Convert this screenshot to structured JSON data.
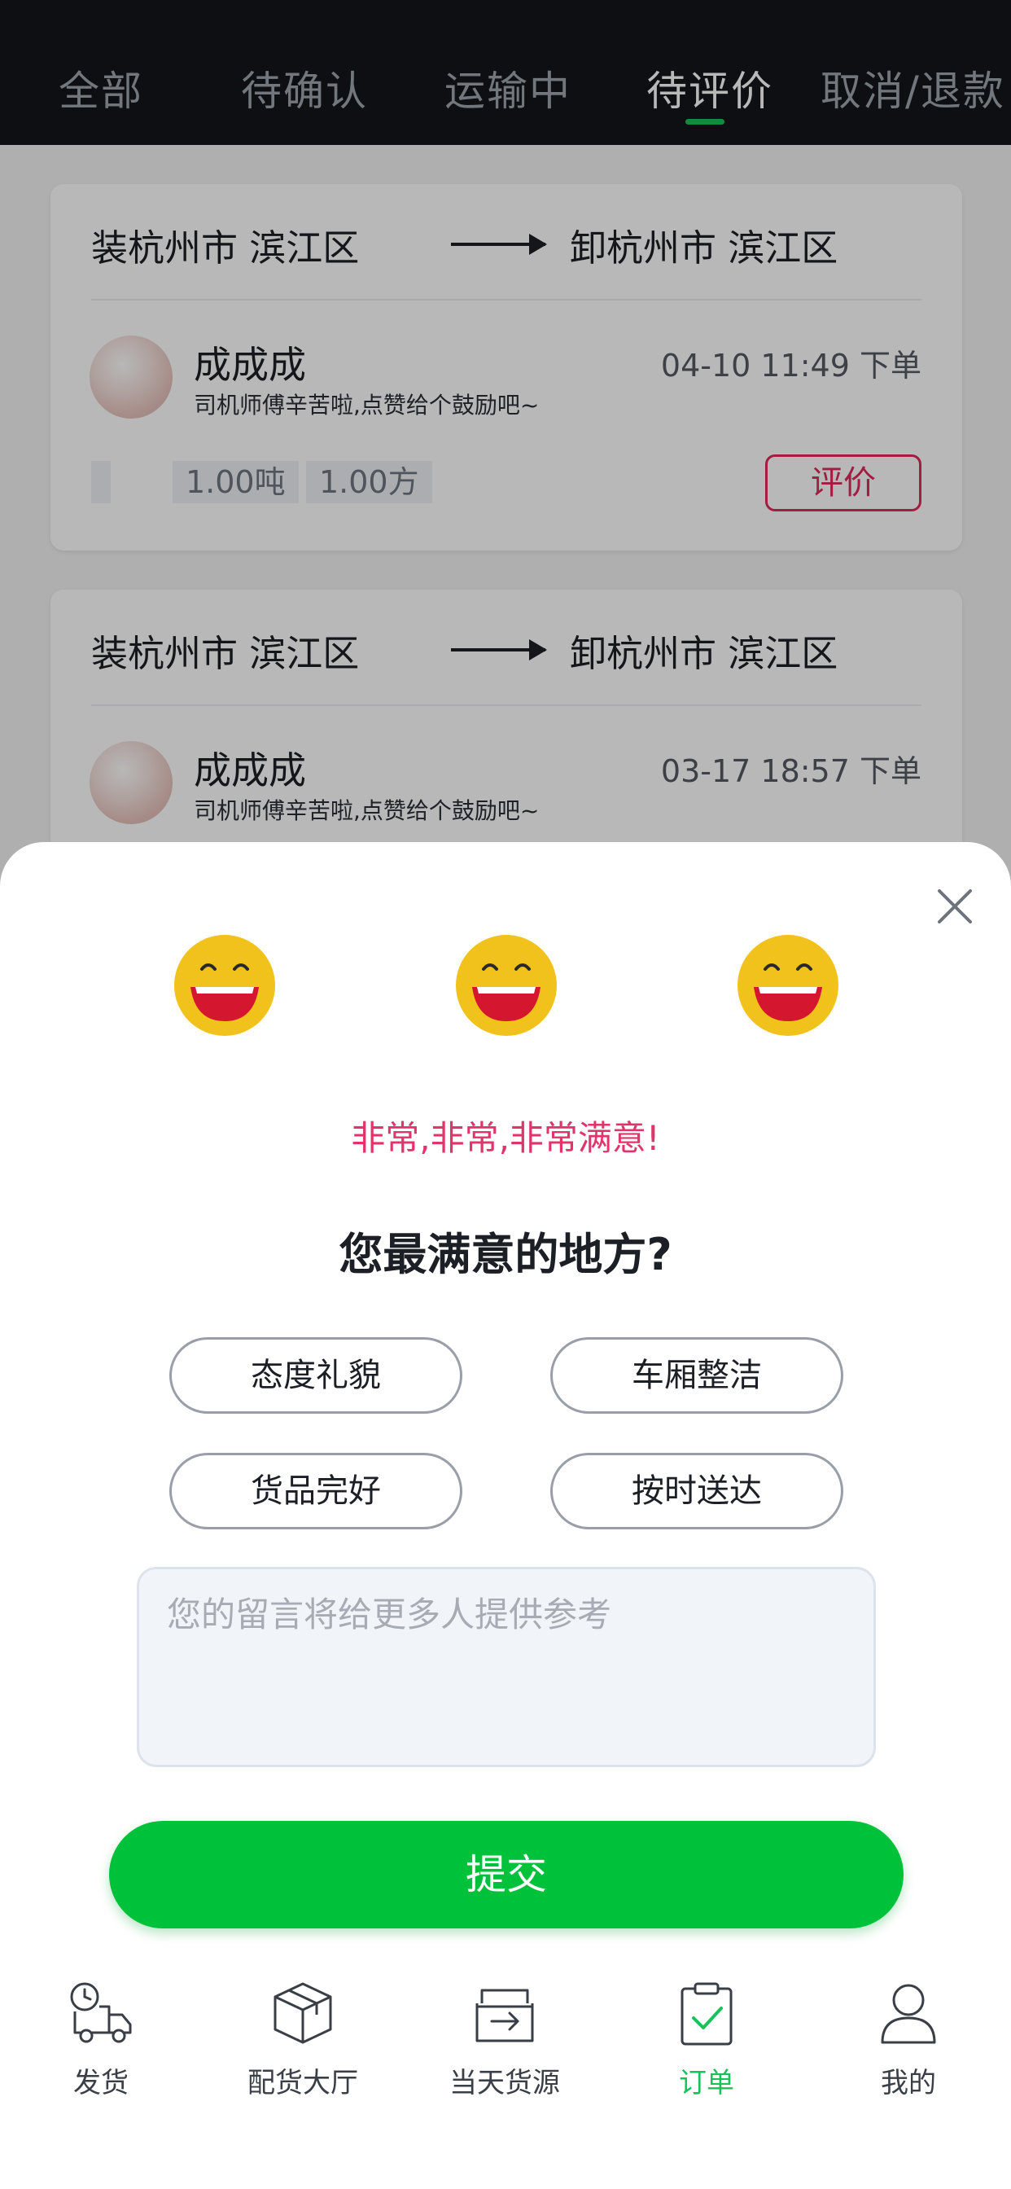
{
  "tabs": [
    "全部",
    "待确认",
    "运输中",
    "待评价",
    "取消/退款"
  ],
  "active_tab": "待评价",
  "orders": [
    {
      "load": "装杭州市 滨江区",
      "unload": "卸杭州市 滨江区",
      "driver": "成成成",
      "driver_note": "司机师傅辛苦啦,点赞给个鼓励吧~",
      "time": "04-10 11:49 下单",
      "weight": "1.00吨",
      "volume": "1.00方",
      "action": "评价"
    },
    {
      "load": "装杭州市 滨江区",
      "unload": "卸杭州市 滨江区",
      "driver": "成成成",
      "driver_note": "司机师傅辛苦啦,点赞给个鼓励吧~",
      "time": "03-17 18:57 下单",
      "weight": "",
      "volume": "",
      "action": ""
    }
  ],
  "review_sheet": {
    "rating_text": "非常,非常,非常满意!",
    "question": "您最满意的地方?",
    "tags": [
      "态度礼貌",
      "车厢整洁",
      "货品完好",
      "按时送达"
    ],
    "comment_placeholder": "您的留言将给更多人提供参考",
    "submit_label": "提交",
    "emoji_icon": "laughing-face-icon"
  },
  "bottom_nav": [
    {
      "label": "发货",
      "icon": "truck-clock-icon"
    },
    {
      "label": "配货大厅",
      "icon": "package-box-icon"
    },
    {
      "label": "当天货源",
      "icon": "inbox-arrow-icon"
    },
    {
      "label": "订单",
      "icon": "clipboard-check-icon"
    },
    {
      "label": "我的",
      "icon": "person-icon"
    }
  ],
  "active_nav": "订单",
  "colors": {
    "brand_green": "#00c13a",
    "accent_pink": "#e0346a",
    "header_bg": "#14161b"
  }
}
